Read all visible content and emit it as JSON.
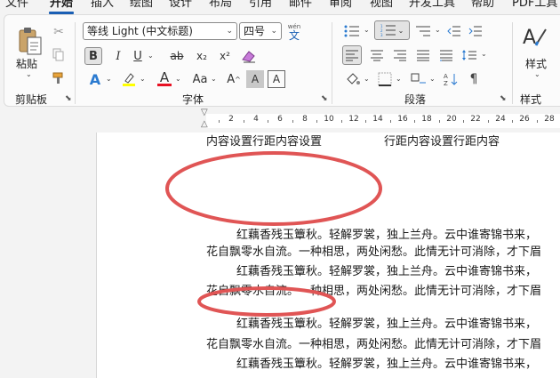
{
  "menu": {
    "items": [
      "文件",
      "开始",
      "插入",
      "绘图",
      "设计",
      "布局",
      "引用",
      "邮件",
      "审阅",
      "视图",
      "开发工具",
      "帮助",
      "PDF工具"
    ],
    "active": "开始"
  },
  "ribbon": {
    "clipboard": {
      "paste_label": "粘贴",
      "group_label": "剪贴板"
    },
    "font": {
      "font_name": "等线 Light (中文标题)",
      "font_size": "四号",
      "wen_glyph_top": "wén",
      "wen_glyph_bottom": "文",
      "bold": "B",
      "italic": "I",
      "underline": "U",
      "strike": "ab",
      "subscript": "x₂",
      "superscript": "x²",
      "text_effects": "A",
      "font_color": "A",
      "char_shading": "A",
      "group_label": "字体"
    },
    "paragraph": {
      "group_label": "段落"
    },
    "styles": {
      "label": "样式",
      "group_label": "样式"
    }
  },
  "ruler": {
    "numbers": [
      "2",
      "4",
      "6",
      "8",
      "10",
      "12",
      "14",
      "16",
      "18",
      "20",
      "22",
      "24",
      "26",
      "28"
    ]
  },
  "document": {
    "header_left": "内容设置行距内容设置",
    "header_right": "行距内容设置行距内容",
    "lines": [
      "红藕香残玉簟秋。轻解罗裳，独上兰舟。云中谁寄锦书来，",
      "花自飘零水自流。一种相思，两处闲愁。此情无计可消除，才下眉",
      "红藕香残玉簟秋。轻解罗裳，独上兰舟。云中谁寄锦书来，",
      "花自飘零水自流。一种相思，两处闲愁。此情无计可消除，才下眉",
      "红藕香残玉簟秋。轻解罗裳，独上兰舟。云中谁寄锦书来，",
      "花自飘零水自流。一种相思，两处闲愁。此情无计可消除，才下眉",
      "红藕香残玉簟秋。轻解罗裳，独上兰舟。云中谁寄锦书来，"
    ]
  },
  "colors": {
    "accent": "#1a5fb4",
    "highlight": "#ffff00",
    "font_red": "#e81123",
    "annotation_red": "#e05555"
  }
}
